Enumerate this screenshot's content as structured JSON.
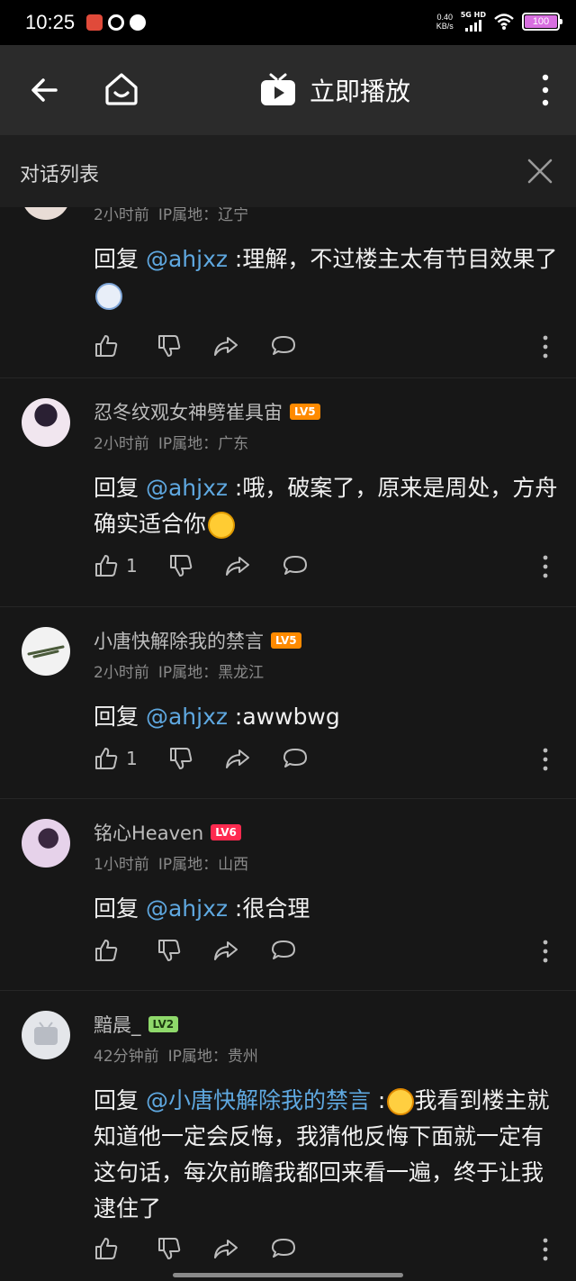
{
  "status": {
    "time": "10:25",
    "net_speed": "0.40",
    "net_unit": "KB/s",
    "net_type": "5G HD",
    "battery": "100"
  },
  "nav": {
    "title": "立即播放"
  },
  "dialog": {
    "title": "对话列表"
  },
  "comments": [
    {
      "time": "2小时前",
      "ip_label": "IP属地：",
      "ip": "辽宁",
      "reply_prefix": "回复 ",
      "mention": "@ahjxz",
      "text": " :理解，不过楼主太有节目效果了",
      "like_count": ""
    },
    {
      "name": "忍冬纹观女神劈崔具宙",
      "level": "LV5",
      "time": "2小时前",
      "ip_label": "IP属地：",
      "ip": "广东",
      "reply_prefix": "回复 ",
      "mention": "@ahjxz",
      "text": " :哦，破案了，原来是周处，方舟确实适合你",
      "like_count": "1"
    },
    {
      "name": "小唐快解除我的禁言",
      "level": "LV5",
      "time": "2小时前",
      "ip_label": "IP属地：",
      "ip": "黑龙江",
      "reply_prefix": "回复 ",
      "mention": "@ahjxz",
      "text": " :awwbwg",
      "like_count": "1"
    },
    {
      "name": "铭心Heaven",
      "level": "LV6",
      "time": "1小时前",
      "ip_label": "IP属地：",
      "ip": "山西",
      "reply_prefix": "回复 ",
      "mention": "@ahjxz",
      "text": " :很合理",
      "like_count": ""
    },
    {
      "name": "黯晨_",
      "level": "LV2",
      "time": "42分钟前",
      "ip_label": "IP属地：",
      "ip": "贵州",
      "reply_prefix": "回复 ",
      "mention": "@小唐快解除我的禁言",
      "text_after_emoji": "我看到楼主就知道他一定会反悔，我猜他反悔下面就一定有这句话，每次前瞻我都回来看一遍，终于让我逮住了",
      "text": " :",
      "like_count": ""
    }
  ],
  "colors": {
    "background": "#171717",
    "mention": "#5fa8e0",
    "lv5": "#ff8a00",
    "lv6": "#ff2a4f",
    "lv2": "#8fd96b"
  }
}
